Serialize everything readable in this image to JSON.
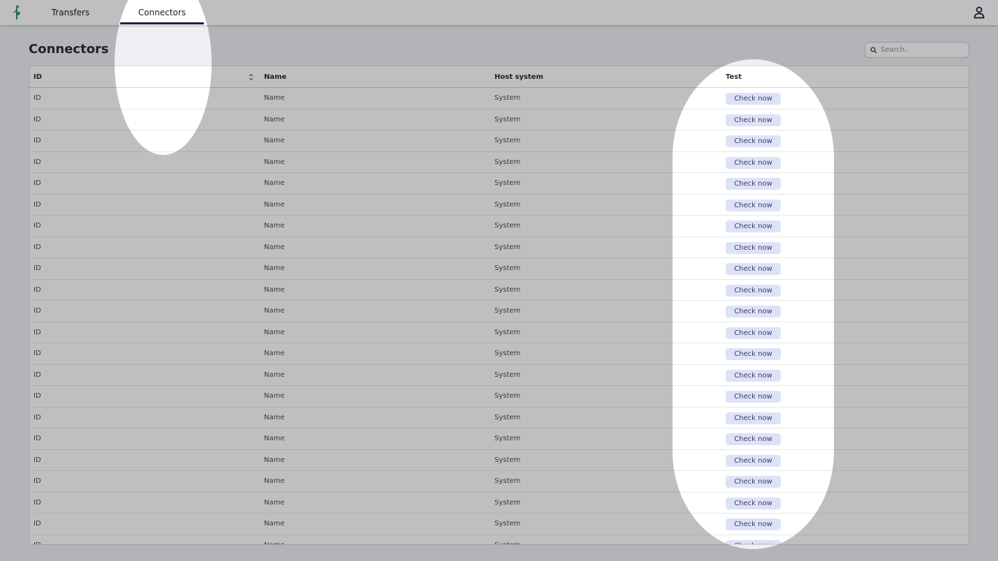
{
  "nav": {
    "tabs": [
      {
        "label": "Transfers",
        "active": false
      },
      {
        "label": "Connectors",
        "active": true
      }
    ],
    "logo_icon": "app-logo-icon",
    "user_icon": "user-icon"
  },
  "page": {
    "title": "Connectors"
  },
  "search": {
    "placeholder": "Search.."
  },
  "table": {
    "columns": [
      "ID",
      "Name",
      "Host system",
      "Test"
    ],
    "button_label": "Check now",
    "rows": [
      {
        "id": "ID",
        "name": "Name",
        "host": "System"
      },
      {
        "id": "ID",
        "name": "Name",
        "host": "System"
      },
      {
        "id": "ID",
        "name": "Name",
        "host": "System"
      },
      {
        "id": "ID",
        "name": "Name",
        "host": "System"
      },
      {
        "id": "ID",
        "name": "Name",
        "host": "System"
      },
      {
        "id": "ID",
        "name": "Name",
        "host": "System"
      },
      {
        "id": "ID",
        "name": "Name",
        "host": "System"
      },
      {
        "id": "ID",
        "name": "Name",
        "host": "System"
      },
      {
        "id": "ID",
        "name": "Name",
        "host": "System"
      },
      {
        "id": "ID",
        "name": "Name",
        "host": "System"
      },
      {
        "id": "ID",
        "name": "Name",
        "host": "System"
      },
      {
        "id": "ID",
        "name": "Name",
        "host": "System"
      },
      {
        "id": "ID",
        "name": "Name",
        "host": "System"
      },
      {
        "id": "ID",
        "name": "Name",
        "host": "System"
      },
      {
        "id": "ID",
        "name": "Name",
        "host": "System"
      },
      {
        "id": "ID",
        "name": "Name",
        "host": "System"
      },
      {
        "id": "ID",
        "name": "Name",
        "host": "System"
      },
      {
        "id": "ID",
        "name": "Name",
        "host": "System"
      },
      {
        "id": "ID",
        "name": "Name",
        "host": "System"
      },
      {
        "id": "ID",
        "name": "Name",
        "host": "System"
      },
      {
        "id": "ID",
        "name": "Name",
        "host": "System"
      },
      {
        "id": "ID",
        "name": "Name",
        "host": "System"
      }
    ]
  },
  "colors": {
    "accent": "#1a1f3e",
    "button_bg": "#dde2f7",
    "logo": "#2e8b67"
  }
}
